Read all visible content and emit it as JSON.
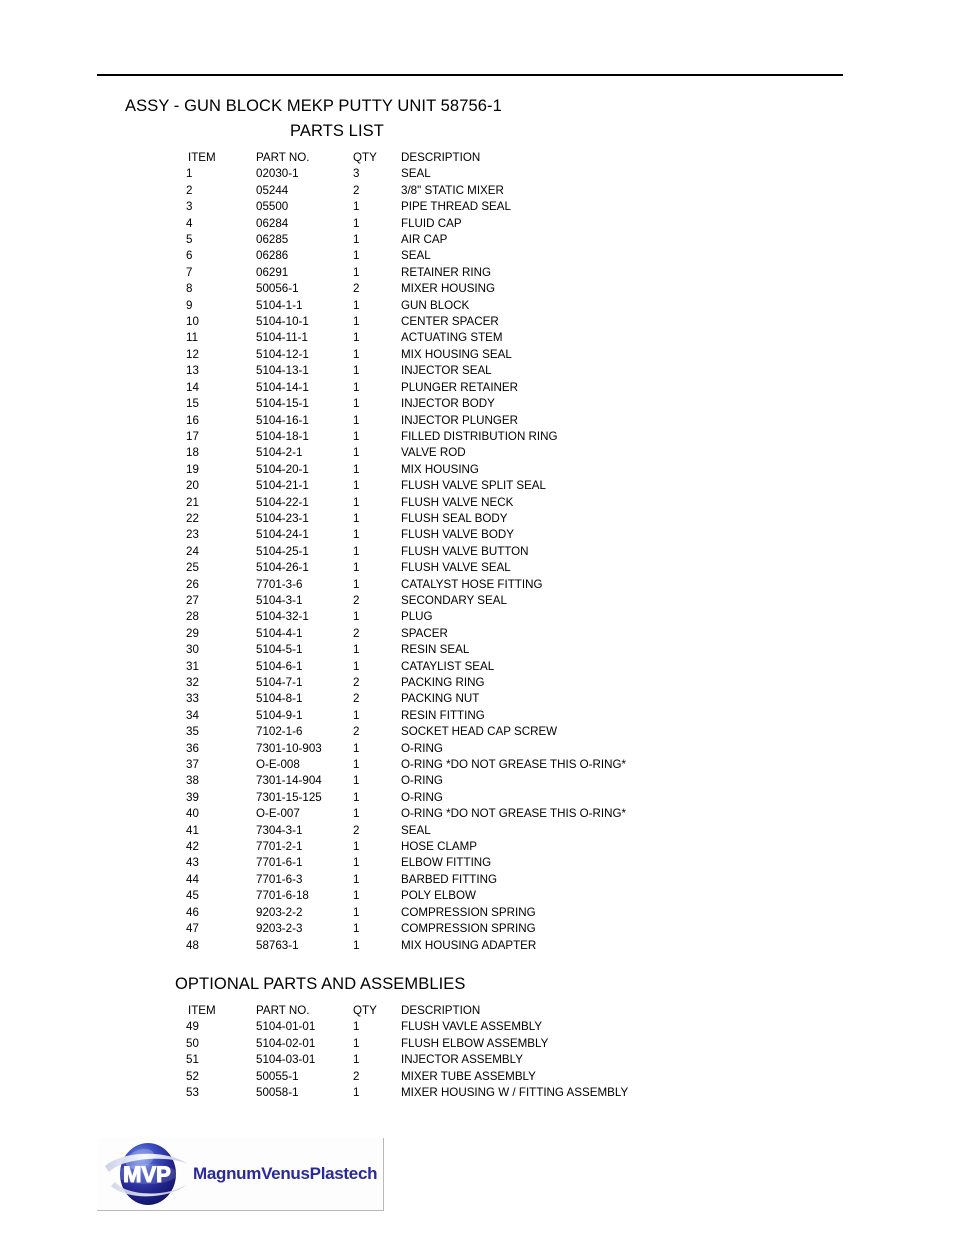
{
  "document": {
    "title": "ASSY - GUN BLOCK MEKP PUTTY UNIT  58756-1",
    "parts_list_heading": "PARTS LIST",
    "optional_heading": "OPTIONAL PARTS AND ASSEMBLIES"
  },
  "columns": {
    "item": "ITEM",
    "part_no": "PART NO.",
    "qty": "QTY",
    "description": "DESCRIPTION"
  },
  "parts": [
    {
      "item": "1",
      "part_no": "02030-1",
      "qty": "3",
      "description": "SEAL"
    },
    {
      "item": "2",
      "part_no": "05244",
      "qty": "2",
      "description": "3/8\" STATIC MIXER"
    },
    {
      "item": "3",
      "part_no": "05500",
      "qty": "1",
      "description": "PIPE THREAD SEAL"
    },
    {
      "item": "4",
      "part_no": "06284",
      "qty": "1",
      "description": "FLUID CAP"
    },
    {
      "item": "5",
      "part_no": "06285",
      "qty": "1",
      "description": "AIR CAP"
    },
    {
      "item": "6",
      "part_no": "06286",
      "qty": "1",
      "description": "SEAL"
    },
    {
      "item": "7",
      "part_no": "06291",
      "qty": "1",
      "description": "RETAINER RING"
    },
    {
      "item": "8",
      "part_no": "50056-1",
      "qty": "2",
      "description": "MIXER HOUSING"
    },
    {
      "item": "9",
      "part_no": "5104-1-1",
      "qty": "1",
      "description": "GUN BLOCK"
    },
    {
      "item": "10",
      "part_no": "5104-10-1",
      "qty": "1",
      "description": "CENTER SPACER"
    },
    {
      "item": "11",
      "part_no": "5104-11-1",
      "qty": "1",
      "description": "ACTUATING STEM"
    },
    {
      "item": "12",
      "part_no": "5104-12-1",
      "qty": "1",
      "description": "MIX HOUSING SEAL"
    },
    {
      "item": "13",
      "part_no": "5104-13-1",
      "qty": "1",
      "description": "INJECTOR SEAL"
    },
    {
      "item": "14",
      "part_no": "5104-14-1",
      "qty": "1",
      "description": "PLUNGER RETAINER"
    },
    {
      "item": "15",
      "part_no": "5104-15-1",
      "qty": "1",
      "description": "INJECTOR BODY"
    },
    {
      "item": "16",
      "part_no": "5104-16-1",
      "qty": "1",
      "description": "INJECTOR PLUNGER"
    },
    {
      "item": "17",
      "part_no": "5104-18-1",
      "qty": "1",
      "description": "FILLED DISTRIBUTION RING"
    },
    {
      "item": "18",
      "part_no": "5104-2-1",
      "qty": "1",
      "description": "VALVE ROD"
    },
    {
      "item": "19",
      "part_no": "5104-20-1",
      "qty": "1",
      "description": "MIX HOUSING"
    },
    {
      "item": "20",
      "part_no": "5104-21-1",
      "qty": "1",
      "description": "FLUSH VALVE SPLIT SEAL"
    },
    {
      "item": "21",
      "part_no": "5104-22-1",
      "qty": "1",
      "description": "FLUSH VALVE NECK"
    },
    {
      "item": "22",
      "part_no": "5104-23-1",
      "qty": "1",
      "description": "FLUSH SEAL BODY"
    },
    {
      "item": "23",
      "part_no": "5104-24-1",
      "qty": "1",
      "description": "FLUSH VALVE BODY"
    },
    {
      "item": "24",
      "part_no": "5104-25-1",
      "qty": "1",
      "description": "FLUSH VALVE BUTTON"
    },
    {
      "item": "25",
      "part_no": "5104-26-1",
      "qty": "1",
      "description": "FLUSH VALVE SEAL"
    },
    {
      "item": "26",
      "part_no": "7701-3-6",
      "qty": "1",
      "description": "CATALYST HOSE FITTING"
    },
    {
      "item": "27",
      "part_no": "5104-3-1",
      "qty": "2",
      "description": "SECONDARY SEAL"
    },
    {
      "item": "28",
      "part_no": "5104-32-1",
      "qty": "1",
      "description": "PLUG"
    },
    {
      "item": "29",
      "part_no": "5104-4-1",
      "qty": "2",
      "description": "SPACER"
    },
    {
      "item": "30",
      "part_no": "5104-5-1",
      "qty": "1",
      "description": "RESIN SEAL"
    },
    {
      "item": "31",
      "part_no": "5104-6-1",
      "qty": "1",
      "description": "CATAYLIST SEAL"
    },
    {
      "item": "32",
      "part_no": "5104-7-1",
      "qty": "2",
      "description": "PACKING RING"
    },
    {
      "item": "33",
      "part_no": "5104-8-1",
      "qty": "2",
      "description": "PACKING NUT"
    },
    {
      "item": "34",
      "part_no": "5104-9-1",
      "qty": "1",
      "description": "RESIN FITTING"
    },
    {
      "item": "35",
      "part_no": "7102-1-6",
      "qty": "2",
      "description": "SOCKET HEAD CAP SCREW"
    },
    {
      "item": "36",
      "part_no": "7301-10-903",
      "qty": "1",
      "description": "O-RING"
    },
    {
      "item": "37",
      "part_no": "O-E-008",
      "qty": "1",
      "description": "O-RING *DO NOT GREASE THIS O-RING*"
    },
    {
      "item": "38",
      "part_no": "7301-14-904",
      "qty": "1",
      "description": "O-RING"
    },
    {
      "item": "39",
      "part_no": "7301-15-125",
      "qty": "1",
      "description": "O-RING"
    },
    {
      "item": "40",
      "part_no": "O-E-007",
      "qty": "1",
      "description": "O-RING *DO NOT GREASE THIS O-RING*"
    },
    {
      "item": "41",
      "part_no": "7304-3-1",
      "qty": "2",
      "description": "SEAL"
    },
    {
      "item": "42",
      "part_no": "7701-2-1",
      "qty": "1",
      "description": "HOSE CLAMP"
    },
    {
      "item": "43",
      "part_no": "7701-6-1",
      "qty": "1",
      "description": "ELBOW FITTING"
    },
    {
      "item": "44",
      "part_no": "7701-6-3",
      "qty": "1",
      "description": "BARBED FITTING"
    },
    {
      "item": "45",
      "part_no": "7701-6-18",
      "qty": "1",
      "description": "POLY ELBOW"
    },
    {
      "item": "46",
      "part_no": "9203-2-2",
      "qty": "1",
      "description": "COMPRESSION SPRING"
    },
    {
      "item": "47",
      "part_no": "9203-2-3",
      "qty": "1",
      "description": "COMPRESSION SPRING"
    },
    {
      "item": "48",
      "part_no": "58763-1",
      "qty": "1",
      "description": "MIX HOUSING ADAPTER"
    }
  ],
  "optional_parts": [
    {
      "item": "49",
      "part_no": "5104-01-01",
      "qty": "1",
      "description": "FLUSH VAVLE ASSEMBLY"
    },
    {
      "item": "50",
      "part_no": "5104-02-01",
      "qty": "1",
      "description": "FLUSH ELBOW ASSEMBLY"
    },
    {
      "item": "51",
      "part_no": "5104-03-01",
      "qty": "1",
      "description": "INJECTOR ASSEMBLY"
    },
    {
      "item": "52",
      "part_no": "50055-1",
      "qty": "2",
      "description": "MIXER TUBE ASSEMBLY"
    },
    {
      "item": "53",
      "part_no": "50058-1",
      "qty": "1",
      "description": "MIXER HOUSING W / FITTING ASSEMBLY"
    }
  ],
  "logo": {
    "mark_text": "MVP",
    "wordmark": "MagnumVenusPlastech",
    "sphere_color": "#2a2f9e",
    "wordmark_color": "#2a2a9c"
  }
}
